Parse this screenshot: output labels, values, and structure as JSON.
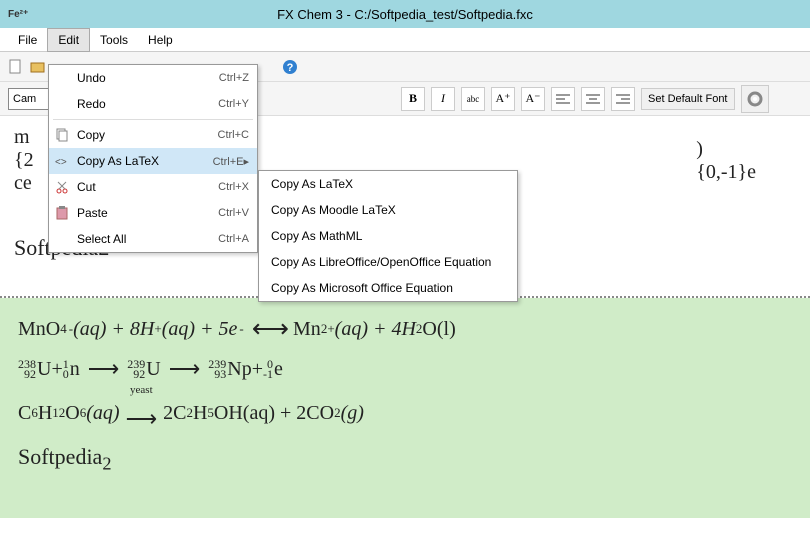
{
  "title": "FX Chem 3 - C:/Softpedia_test/Softpedia.fxc",
  "app_icon": "Fe²⁺",
  "menubar": {
    "file": "File",
    "edit": "Edit",
    "tools": "Tools",
    "help": "Help"
  },
  "toolbar2": {
    "font": "Cam",
    "bold": "B",
    "italic": "I",
    "underline": "abc",
    "a_plus": "A⁺",
    "a_minus": "A⁻",
    "set_default": "Set Default Font"
  },
  "edit_menu": {
    "undo": {
      "label": "Undo",
      "shortcut": "Ctrl+Z"
    },
    "redo": {
      "label": "Redo",
      "shortcut": "Ctrl+Y"
    },
    "copy": {
      "label": "Copy",
      "shortcut": "Ctrl+C"
    },
    "copy_latex": {
      "label": "Copy As LaTeX",
      "shortcut": "Ctrl+E▸"
    },
    "cut": {
      "label": "Cut",
      "shortcut": "Ctrl+X"
    },
    "paste": {
      "label": "Paste",
      "shortcut": "Ctrl+V"
    },
    "select_all": {
      "label": "Select All",
      "shortcut": "Ctrl+A"
    }
  },
  "submenu": {
    "latex": "Copy As LaTeX",
    "moodle": "Copy As Moodle LaTeX",
    "mathml": "Copy As MathML",
    "libre": "Copy As LibreOffice/OpenOffice Equation",
    "msoffice": "Copy As Microsoft Office Equation"
  },
  "editor": {
    "left_fragment_m": "m",
    "left_fragment_brace": "{2",
    "left_fragment_ce": "ce",
    "right_fragment_1": ")",
    "right_fragment_2": "{0,-1}e",
    "softpedia2": "Softpedia2"
  },
  "preview": {
    "line1_a": "MnO",
    "line1_b": "(aq) + 8H",
    "line1_c": "(aq) + 5e",
    "line1_d": "Mn",
    "line1_e": "(aq) + 4H",
    "line1_f": "O(l)",
    "iso_238": "238",
    "iso_92": "92",
    "U": "U",
    "plus": " + ",
    "iso_1": "1",
    "iso_0": "0",
    "n": "n",
    "iso_239": "239",
    "iso_93": "93",
    "Np": "Np",
    "iso_0b": "0",
    "iso_m1": "-1",
    "e": "e",
    "line3_a": "C",
    "line3_b": "H",
    "line3_c": "O",
    "line3_d": "(aq)",
    "yeast": "yeast",
    "line3_e": "2C",
    "line3_f": "H",
    "line3_g": "OH(aq) + 2CO",
    "line3_h": "(g)",
    "softpedia": "Softpedia"
  }
}
